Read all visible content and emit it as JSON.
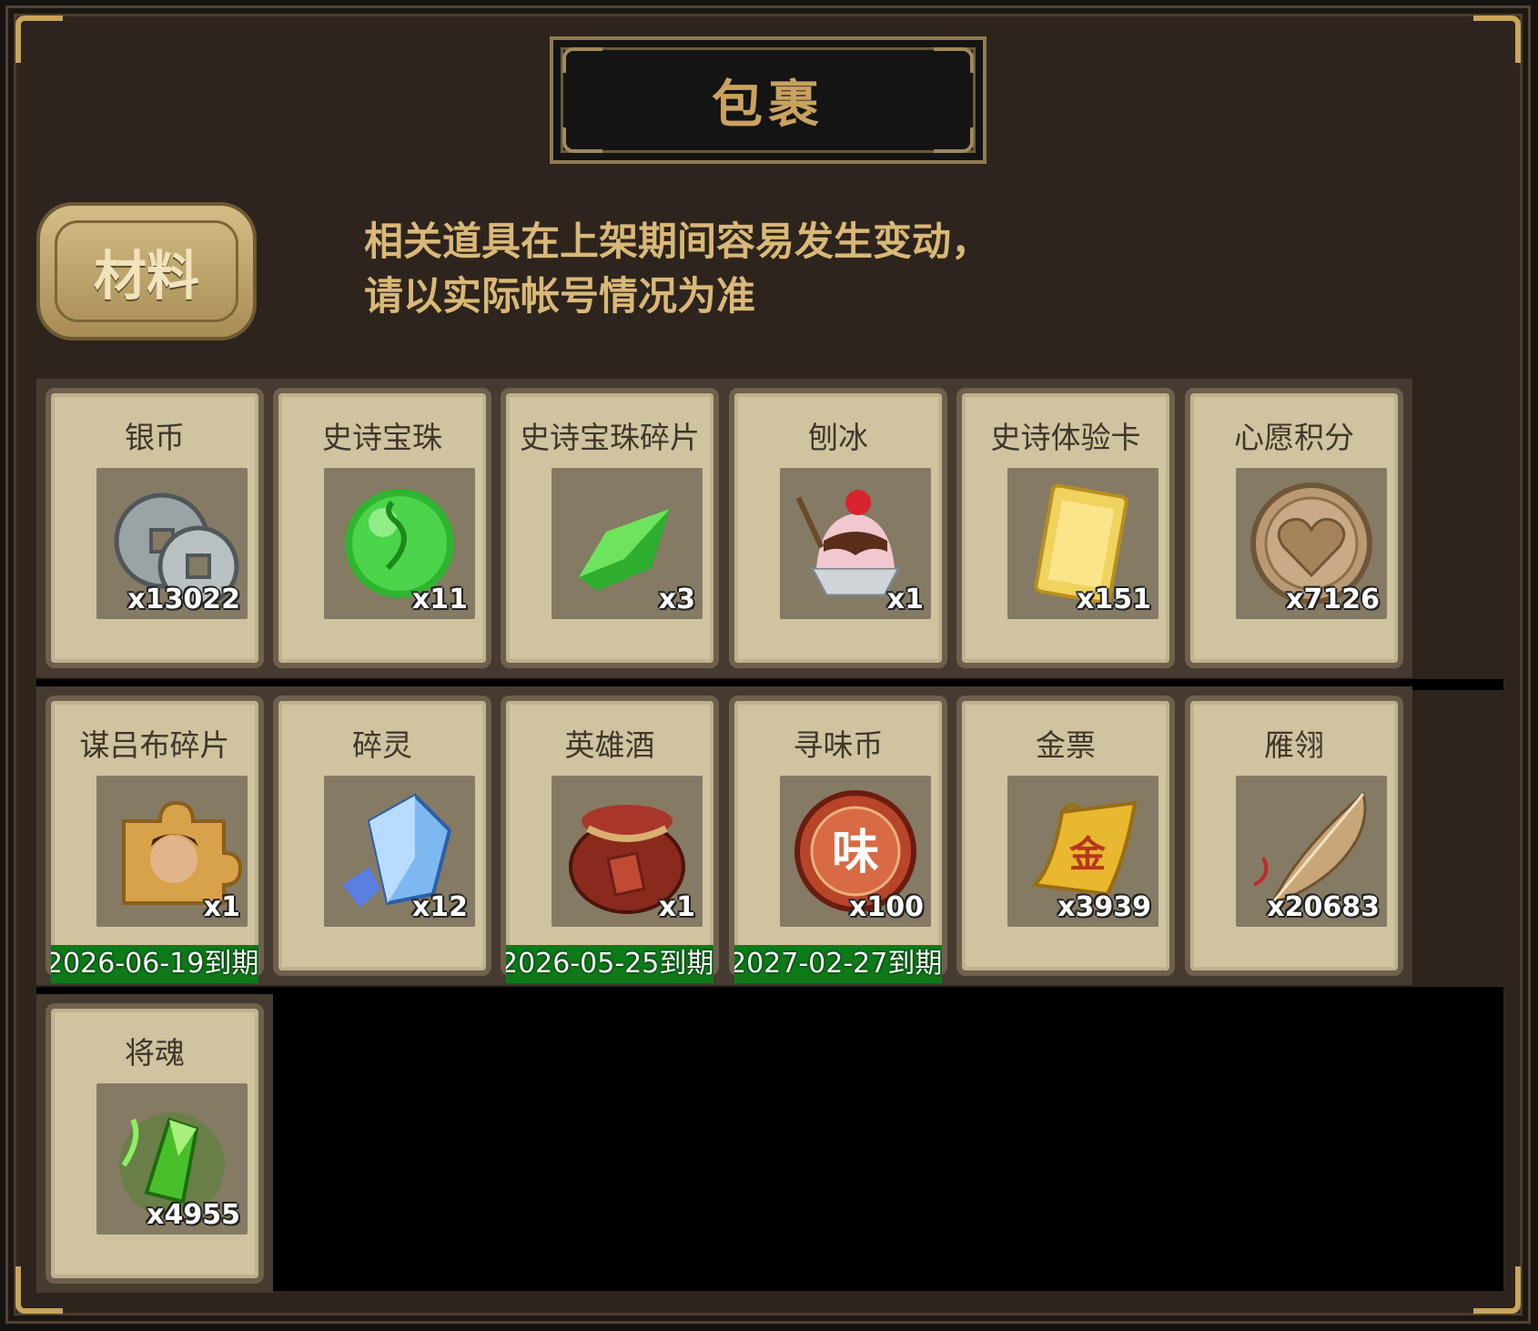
{
  "window": {
    "title": "包裹",
    "tab_label": "材料",
    "notice_line1": "相关道具在上架期间容易发生变动，",
    "notice_line2": "请以实际帐号情况为准"
  },
  "colors": {
    "panel": "#2d241d",
    "gold_text": "#d9b878",
    "card_bg": "#cfc3a0",
    "expiry_green": "#0e7a1a"
  },
  "items": [
    {
      "name": "银币",
      "count": "x13022",
      "icon": "silver-coin-icon",
      "expiry": ""
    },
    {
      "name": "史诗宝珠",
      "count": "x11",
      "icon": "green-orb-icon",
      "expiry": ""
    },
    {
      "name": "史诗宝珠碎片",
      "count": "x3",
      "icon": "green-shard-icon",
      "expiry": ""
    },
    {
      "name": "刨冰",
      "count": "x1",
      "icon": "shaved-ice-icon",
      "expiry": ""
    },
    {
      "name": "史诗体验卡",
      "count": "x151",
      "icon": "gold-card-icon",
      "expiry": ""
    },
    {
      "name": "心愿积分",
      "count": "x7126",
      "icon": "heart-coin-icon",
      "expiry": ""
    },
    {
      "name": "谋吕布碎片",
      "count": "x1",
      "icon": "hero-puzzle-icon",
      "expiry": "2026-06-19到期"
    },
    {
      "name": "碎灵",
      "count": "x12",
      "icon": "blue-crystal-icon",
      "expiry": ""
    },
    {
      "name": "英雄酒",
      "count": "x1",
      "icon": "wine-jar-icon",
      "expiry": "2026-05-25到期"
    },
    {
      "name": "寻味币",
      "count": "x100",
      "icon": "flavor-coin-icon",
      "expiry": "2027-02-27到期"
    },
    {
      "name": "金票",
      "count": "x3939",
      "icon": "gold-ticket-icon",
      "expiry": ""
    },
    {
      "name": "雁翎",
      "count": "x20683",
      "icon": "feather-icon",
      "expiry": ""
    },
    {
      "name": "将魂",
      "count": "x4955",
      "icon": "green-soul-icon",
      "expiry": ""
    }
  ]
}
